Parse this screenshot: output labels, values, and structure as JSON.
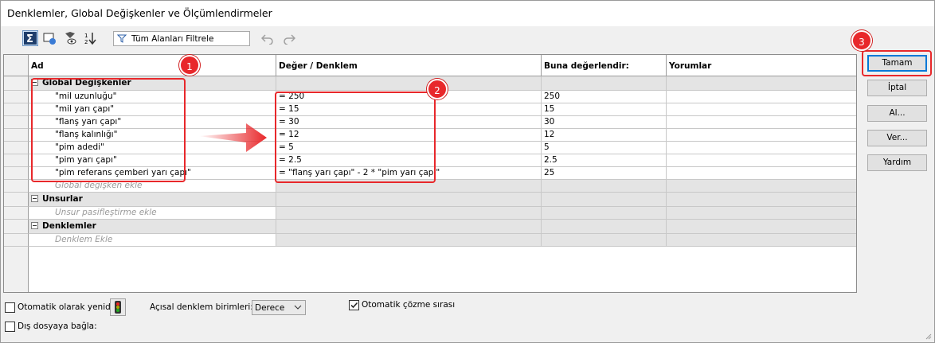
{
  "window": {
    "title": "Denklemler, Global Değişkenler ve Ölçümlendirmeler"
  },
  "toolbar": {
    "icons": [
      "sigma-icon",
      "display-icon",
      "filter-eye-icon",
      "sort-order-icon"
    ],
    "filter_label": "Tüm Alanları Filtrele"
  },
  "table": {
    "headers": {
      "name": "Ad",
      "value": "Değer / Denklem",
      "evaluates": "Buna değerlendir:",
      "comments": "Yorumlar"
    },
    "groups": [
      {
        "title": "Global Değişkenler",
        "rows": [
          {
            "name": "\"mil uzunluğu\"",
            "value": "= 250",
            "evaluates": "250"
          },
          {
            "name": "\"mil yarı çapı\"",
            "value": "= 15",
            "evaluates": "15"
          },
          {
            "name": "\"flanş yarı çapı\"",
            "value": "= 30",
            "evaluates": "30"
          },
          {
            "name": "\"flanş kalınlığı\"",
            "value": "= 12",
            "evaluates": "12"
          },
          {
            "name": "\"pim adedi\"",
            "value": "= 5",
            "evaluates": "5"
          },
          {
            "name": "\"pim yarı çapı\"",
            "value": "= 2.5",
            "evaluates": "2.5"
          },
          {
            "name": "\"pim referans çemberi yarı çapı\"",
            "value": "= \"flanş yarı çapı\" - 2 * \"pim yarı çapı\"",
            "evaluates": "25"
          }
        ],
        "add_hint": "Global değişken ekle"
      },
      {
        "title": "Unsurlar",
        "rows": [],
        "add_hint": "Unsur pasifleştirme ekle"
      },
      {
        "title": "Denklemler",
        "rows": [],
        "add_hint": "Denklem Ekle"
      }
    ]
  },
  "buttons": {
    "ok": "Tamam",
    "cancel": "İptal",
    "open": "Al...",
    "export": "Ver...",
    "help": "Yardım"
  },
  "annotations": {
    "badge1": "1",
    "badge2": "2",
    "badge3": "3",
    "accent": "#e8282b"
  },
  "bottom": {
    "auto_rebuild": "Otomatik olarak yenid",
    "angular_units_label": "Açısal denklem birimleri:",
    "angular_units_value": "Derece",
    "auto_solve_order": "Otomatik çözme sırası",
    "link_external": "Dış dosyaya bağla:"
  }
}
